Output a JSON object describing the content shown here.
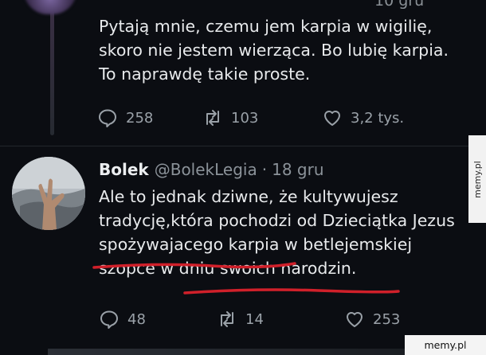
{
  "top_tweet": {
    "time_partial": "10 gru",
    "text": "Pytają mnie, czemu jem karpia w wigilię,\nskoro nie jestem wierząca. Bo lubię karpia.\nTo naprawdę takie proste.",
    "replies": "258",
    "retweets": "103",
    "likes": "3,2 tys."
  },
  "reply_tweet": {
    "name": "Bolek",
    "handle": "@BolekLegia",
    "separator": "·",
    "date": "18 gru",
    "text": "Ale to jednak dziwne, że kultywujesz\ntradycję,która pochodzi od Dzieciątka Jezus\nspożywajacego karpia w betlejemskiej\nszopce w dniu swoich narodzin.",
    "replies": "48",
    "retweets": "14",
    "likes": "253"
  },
  "annotation_color": "#d0202a",
  "watermarks": {
    "side": "memy.pl",
    "bottom": "memy.pl"
  }
}
